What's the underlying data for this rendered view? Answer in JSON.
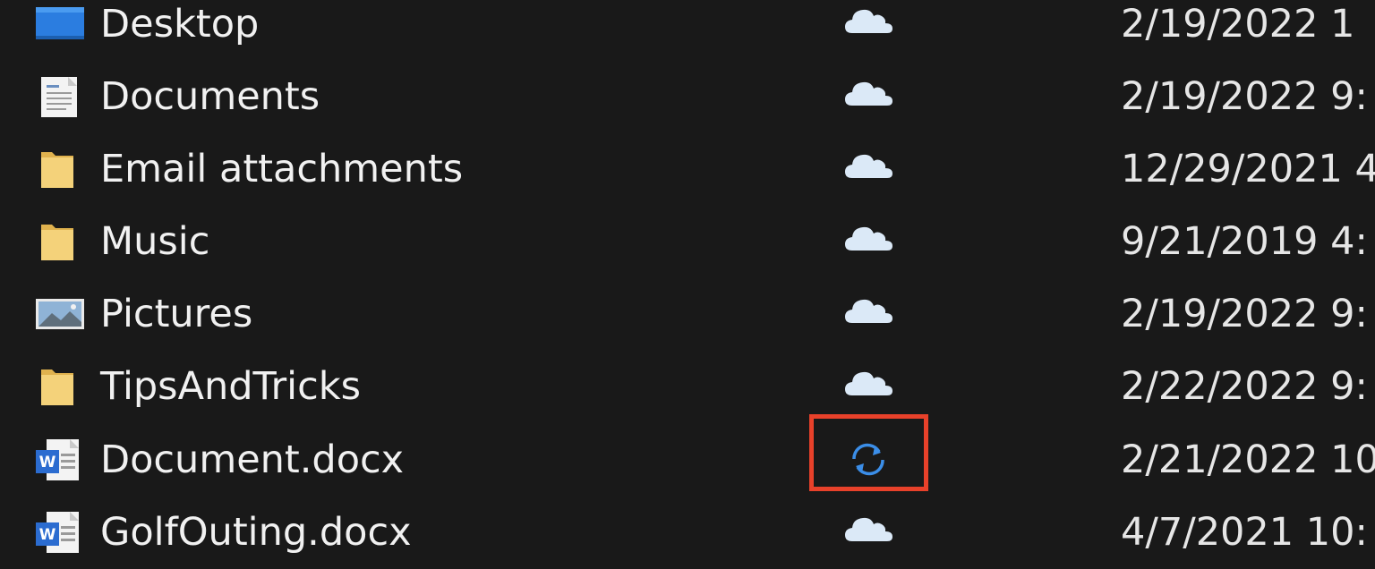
{
  "file_list": {
    "rows": [
      {
        "name": "Desktop",
        "icon": "desktop-folder-icon",
        "status": "cloud-online-icon",
        "date": "2/19/2022 1"
      },
      {
        "name": "Documents",
        "icon": "documents-folder-icon",
        "status": "cloud-online-icon",
        "date": "2/19/2022 9:"
      },
      {
        "name": "Email attachments",
        "icon": "folder-icon",
        "status": "cloud-online-icon",
        "date": "12/29/2021 4"
      },
      {
        "name": "Music",
        "icon": "folder-icon",
        "status": "cloud-online-icon",
        "date": "9/21/2019 4:"
      },
      {
        "name": "Pictures",
        "icon": "pictures-folder-icon",
        "status": "cloud-online-icon",
        "date": "2/19/2022 9:"
      },
      {
        "name": "TipsAndTricks",
        "icon": "folder-icon",
        "status": "cloud-online-icon",
        "date": "2/22/2022 9:"
      },
      {
        "name": "Document.docx",
        "icon": "word-document-icon",
        "status": "sync-pending-icon",
        "date": "2/21/2022 10"
      },
      {
        "name": "GolfOuting.docx",
        "icon": "word-document-icon",
        "status": "cloud-online-icon",
        "date": "4/7/2021 10:"
      }
    ]
  },
  "colors": {
    "background": "#191919",
    "text": "#f1f1f1",
    "cloud_status": "#dbe9f7",
    "sync_status": "#3b8ee8",
    "folder_yellow": "#f4d27a",
    "highlight_border": "#e8412a"
  }
}
